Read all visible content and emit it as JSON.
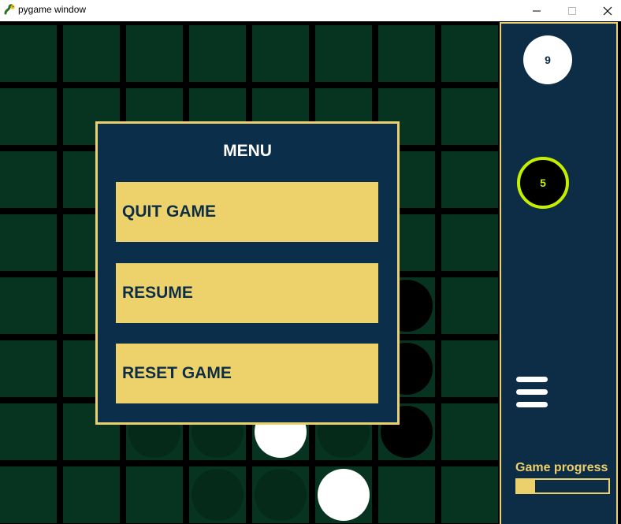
{
  "window": {
    "title": "pygame window",
    "icon": "pygame-snake-icon",
    "controls": [
      "minimize-icon",
      "maximize-icon",
      "close-icon"
    ]
  },
  "board": {
    "rows": 8,
    "cols": 8,
    "colors": {
      "cell": "#073421",
      "grid": "#000000",
      "ghost": "#052a1a"
    },
    "pieces": [
      {
        "row": 4,
        "col": 6,
        "color": "black"
      },
      {
        "row": 5,
        "col": 6,
        "color": "black"
      },
      {
        "row": 6,
        "col": 2,
        "color": "ghost"
      },
      {
        "row": 6,
        "col": 3,
        "color": "ghost"
      },
      {
        "row": 6,
        "col": 4,
        "color": "white"
      },
      {
        "row": 6,
        "col": 5,
        "color": "ghost"
      },
      {
        "row": 6,
        "col": 6,
        "color": "black"
      },
      {
        "row": 7,
        "col": 3,
        "color": "ghost"
      },
      {
        "row": 7,
        "col": 4,
        "color": "ghost"
      },
      {
        "row": 7,
        "col": 5,
        "color": "white"
      }
    ]
  },
  "sidebar": {
    "white_score": "9",
    "black_score": "5",
    "menu_icon": "hamburger-menu-icon",
    "progress_label": "Game progress",
    "progress_fraction": 0.2
  },
  "menu": {
    "title": "MENU",
    "quit_label": "QUIT GAME",
    "resume_label": "RESUME",
    "reset_label": "RESET GAME"
  },
  "colors": {
    "accent": "#ebd06b",
    "panel": "#0d2d46",
    "active_highlight": "#c4f000"
  }
}
